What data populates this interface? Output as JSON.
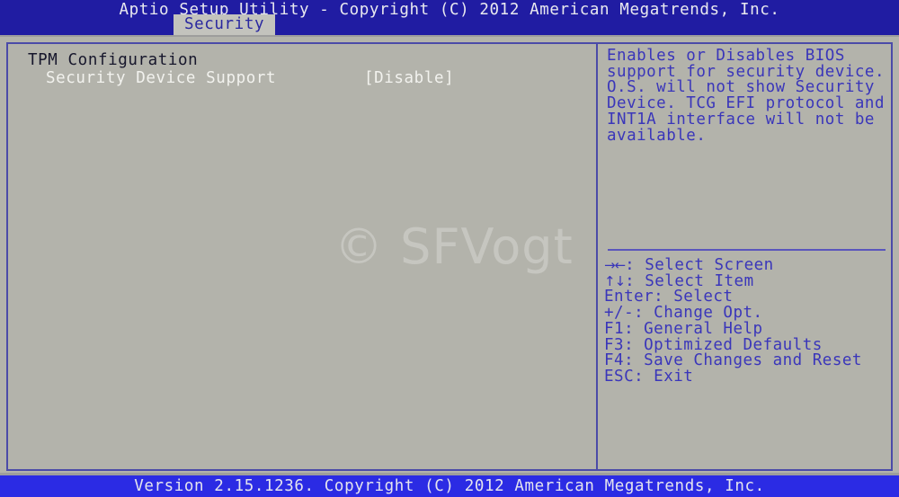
{
  "titlebar": {
    "title": "Aptio Setup Utility - Copyright (C) 2012 American Megatrends, Inc."
  },
  "tabs": [
    {
      "label": "Security",
      "active": true
    }
  ],
  "settings": {
    "group_title": "TPM Configuration",
    "rows": [
      {
        "label": "Security Device Support",
        "value": "[Disable]",
        "selected": true
      }
    ]
  },
  "help": {
    "lines": [
      "Enables or Disables BIOS",
      "support for security device.",
      "O.S. will not show Security",
      "Device. TCG EFI protocol and",
      "INT1A interface will not be",
      "available."
    ]
  },
  "key_legend": [
    {
      "glyph": "→←",
      "text": ": Select Screen"
    },
    {
      "glyph": "↑↓",
      "text": ": Select Item"
    },
    {
      "glyph": "",
      "text": "Enter: Select"
    },
    {
      "glyph": "",
      "text": "+/-: Change Opt."
    },
    {
      "glyph": "",
      "text": "F1: General Help"
    },
    {
      "glyph": "",
      "text": "F3: Optimized Defaults"
    },
    {
      "glyph": "",
      "text": "F4: Save Changes and Reset"
    },
    {
      "glyph": "",
      "text": "ESC: Exit"
    }
  ],
  "footer": {
    "version_text": "Version 2.15.1236. Copyright (C) 2012 American Megatrends, Inc."
  },
  "watermark": {
    "text": "© SFVogt"
  },
  "colors": {
    "header_blue": "#201ca2",
    "footer_blue": "#2b2be4",
    "body_gray": "#b3b3ab",
    "frame_blue": "#4b4ba8",
    "help_text_blue": "#3a36ba",
    "selected_text": "#f2f2ee",
    "group_title_text": "#17172c",
    "tab_active_bg": "#c3c3bd"
  }
}
